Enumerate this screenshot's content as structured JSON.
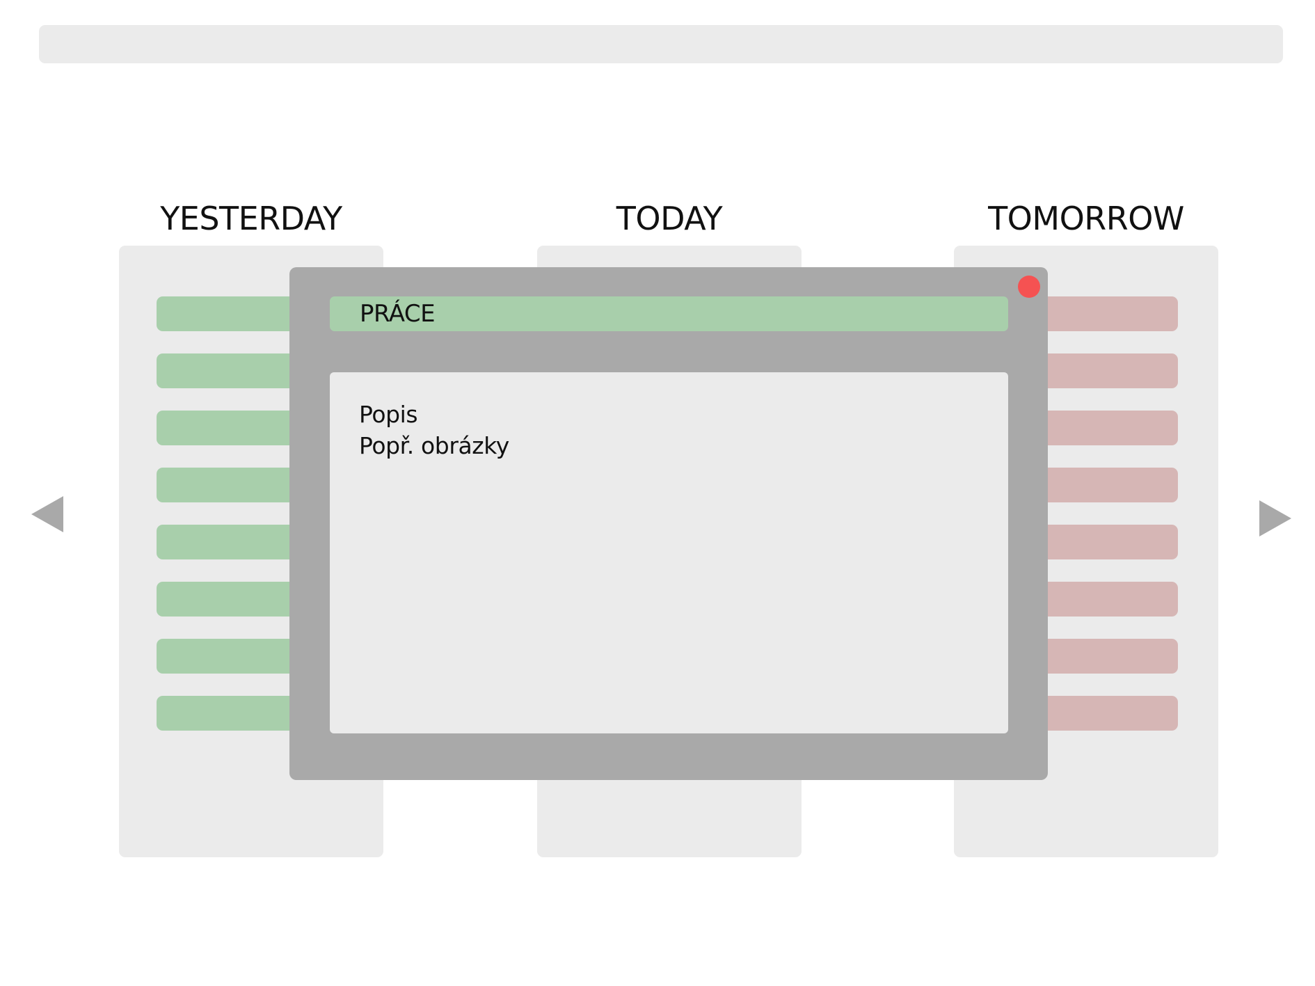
{
  "colors": {
    "past_task": "#a8cfab",
    "future_task": "#d6b6b5",
    "close_button": "#f55252"
  },
  "columns": [
    {
      "id": "yesterday",
      "title": "YESTERDAY",
      "task_count": 8,
      "status": "past"
    },
    {
      "id": "today",
      "title": "TODAY",
      "task_count": 0,
      "status": "current"
    },
    {
      "id": "tomorrow",
      "title": "TOMORROW",
      "task_count": 8,
      "status": "future"
    }
  ],
  "navigation": {
    "prev_icon": "triangle-left-icon",
    "next_icon": "triangle-right-icon"
  },
  "modal": {
    "title": "PRÁCE",
    "close_icon": "close-dot-icon",
    "description_line": "Popis",
    "images_line": "Popř. obrázky"
  }
}
